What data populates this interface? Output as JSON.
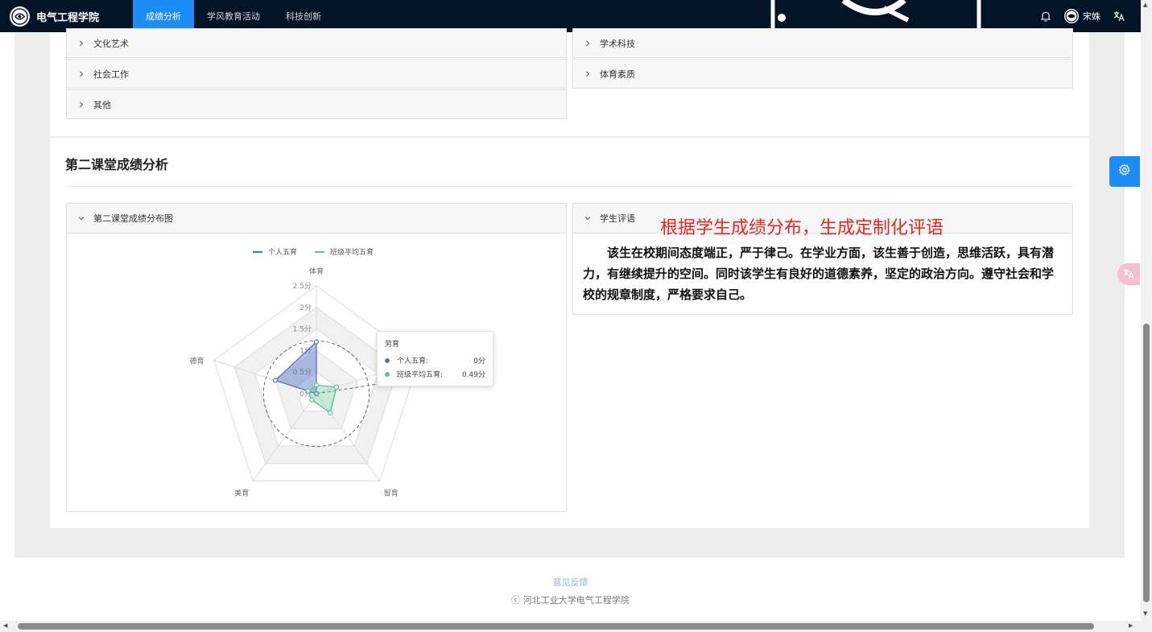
{
  "header": {
    "brand": "电气工程学院",
    "nav": [
      {
        "label": "成绩分析",
        "active": true
      },
      {
        "label": "学风教育活动",
        "active": false
      },
      {
        "label": "科技创新",
        "active": false
      }
    ],
    "user_name": "宋姝",
    "icons": [
      "bell-icon",
      "user-avatar-icon",
      "translate-icon"
    ]
  },
  "categories": {
    "left": [
      "文化艺术",
      "社会工作",
      "其他"
    ],
    "right": [
      "学术科技",
      "体育素质"
    ]
  },
  "section": {
    "title": "第二课堂成绩分析"
  },
  "chart_panel": {
    "title": "第二课堂成绩分布图"
  },
  "comment_panel": {
    "title": "学生评语",
    "overlay": "根据学生成绩分布，生成定制化评语",
    "text": "该生在校期间态度端正，严于律己。在学业方面，该生善于创造，思维活跃，具有潜力，有继续提升的空间。同时该学生有良好的道德素养，坚定的政治方向。遵守社会和学校的规章制度，严格要求自己。"
  },
  "chart_data": {
    "type": "radar",
    "indicators": [
      "体育",
      "劳育",
      "智育",
      "美育",
      "德育"
    ],
    "max": 2.5,
    "ticks": [
      "0分",
      "0.5分",
      "1分",
      "1.5分",
      "2分",
      "2.5分"
    ],
    "series": [
      {
        "name": "个人五育",
        "values": [
          1.2,
          0,
          0,
          0,
          1.0
        ],
        "color": "#5470c6"
      },
      {
        "name": "班级平均五育",
        "values": [
          0.2,
          0.49,
          0.55,
          0.18,
          0.2
        ],
        "color": "#5ac48f"
      }
    ],
    "legend": "top-center",
    "tooltip": {
      "title": "劳育",
      "rows": [
        {
          "name": "个人五育:",
          "value": "0分",
          "color": "#5470c6"
        },
        {
          "name": "班级平均五育:",
          "value": "0.49分",
          "color": "#5ac48f"
        }
      ]
    }
  },
  "footer": {
    "feedback": "意见反馈",
    "copyright": "ⓒ 河北工业大学电气工程学院"
  },
  "colors": {
    "nav_bg": "#031427",
    "accent": "#1d8cf5",
    "overlay_text": "#e8261f"
  }
}
